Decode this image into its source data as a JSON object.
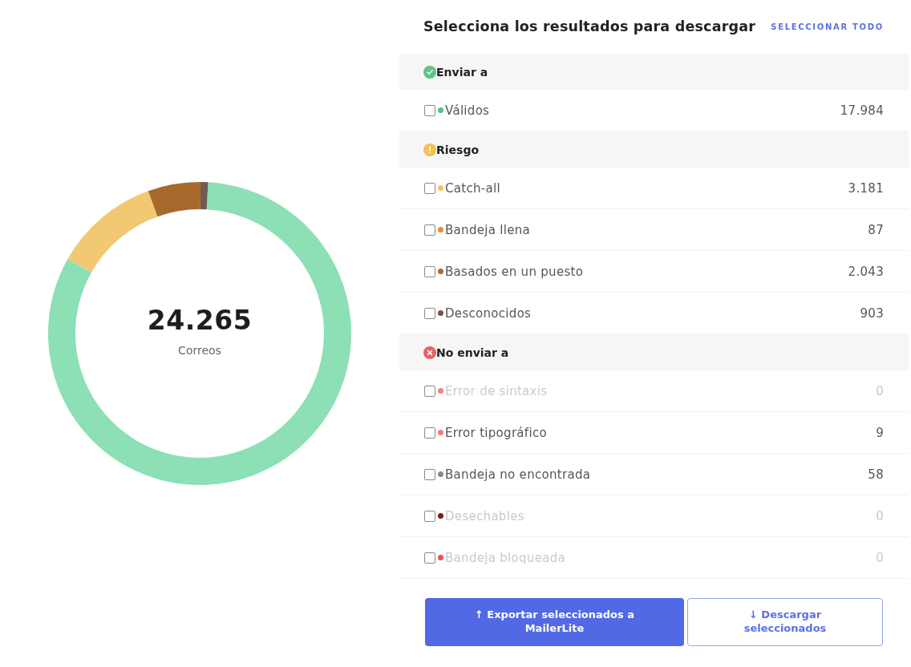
{
  "chart": {
    "total": "24.265",
    "total_label": "Correos",
    "chart_data": {
      "type": "donut",
      "values": [
        82.3,
        11.3,
        5.6,
        0.8
      ],
      "colors": [
        "#8ddfb6",
        "#f2c872",
        "#a8692c",
        "#6f5b52"
      ]
    }
  },
  "panel": {
    "title": "Selecciona los resultados para descargar",
    "select_all": "SELECCIONAR TODO",
    "groups": [
      {
        "title": "Enviar a",
        "kind": "ok",
        "items": [
          {
            "label": "Válidos",
            "count": "17.984",
            "color": "#4fc283",
            "checked": false,
            "disabled": false
          }
        ]
      },
      {
        "title": "Riesgo",
        "kind": "warning",
        "items": [
          {
            "label": "Catch-all",
            "count": "3.181",
            "color": "#f2c45a",
            "checked": false,
            "disabled": false
          },
          {
            "label": "Bandeja llena",
            "count": "87",
            "color": "#e98a3c",
            "checked": false,
            "disabled": false
          },
          {
            "label": "Basados en un puesto",
            "count": "2.043",
            "color": "#b26a26",
            "checked": false,
            "disabled": false
          },
          {
            "label": "Desconocidos",
            "count": "903",
            "color": "#7a5046",
            "checked": false,
            "disabled": false
          }
        ]
      },
      {
        "title": "No enviar a",
        "kind": "error",
        "items": [
          {
            "label": "Error de sintaxis",
            "count": "0",
            "color": "#f08282",
            "checked": false,
            "disabled": true
          },
          {
            "label": "Error tipográfico",
            "count": "9",
            "color": "#f07c7c",
            "checked": false,
            "disabled": false
          },
          {
            "label": "Bandeja no encontrada",
            "count": "58",
            "color": "#8a8a8a",
            "checked": false,
            "disabled": false
          },
          {
            "label": "Desechables",
            "count": "0",
            "color": "#7a1c1c",
            "checked": false,
            "disabled": true
          },
          {
            "label": "Bandeja bloqueada",
            "count": "0",
            "color": "#e85454",
            "checked": false,
            "disabled": true
          }
        ]
      }
    ],
    "buttons": [
      {
        "label": "↑ Exportar seleccionados a MailerLite",
        "kind": "primary"
      },
      {
        "label": "↓ Descargar seleccionados",
        "kind": "secondary"
      }
    ]
  }
}
